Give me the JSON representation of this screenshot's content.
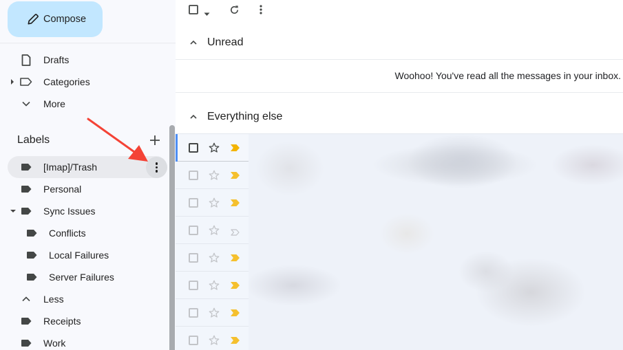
{
  "sidebar": {
    "compose_label": "Compose",
    "nav_items": [
      {
        "label": "Drafts",
        "icon": "draft-icon"
      },
      {
        "label": "Categories",
        "icon": "label-outline-icon"
      },
      {
        "label": "More",
        "icon": "chevron-down-icon"
      }
    ],
    "labels_heading": "Labels",
    "labels": [
      {
        "label": "[Imap]/Trash"
      },
      {
        "label": "Personal"
      },
      {
        "label": "Sync Issues"
      },
      {
        "label": "Conflicts"
      },
      {
        "label": "Local Failures"
      },
      {
        "label": "Server Failures"
      },
      {
        "label": "Less"
      },
      {
        "label": "Receipts"
      },
      {
        "label": "Work"
      }
    ]
  },
  "toolbar": {
    "select_icon": "checkbox-icon",
    "refresh_icon": "refresh-icon",
    "more_icon": "more-vert-icon"
  },
  "sections": {
    "unread_title": "Unread",
    "unread_empty_message": "Woohoo! You've read all the messages in your inbox.",
    "everything_else_title": "Everything else"
  },
  "rows": [
    {
      "important": true,
      "selected": true
    },
    {
      "important": true
    },
    {
      "important": true
    },
    {
      "important": false
    },
    {
      "important": true
    },
    {
      "important": true
    },
    {
      "important": true
    },
    {
      "important": true
    }
  ],
  "colors": {
    "compose_bg": "#c2e7ff",
    "important_marker": "#f5c02e",
    "selection_bar": "#4d8ef5",
    "annotation_arrow": "#f44336"
  }
}
